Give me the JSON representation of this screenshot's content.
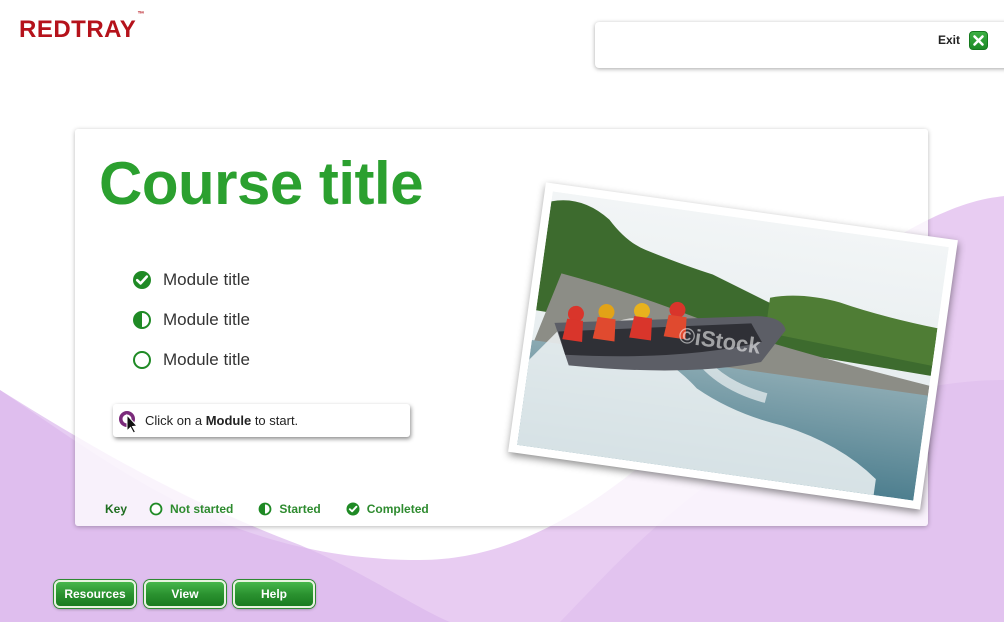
{
  "brand": {
    "name": "REDTRAY",
    "trademark": "™",
    "color": "#b5121b"
  },
  "header": {
    "exit_label": "Exit",
    "exit_icon": "close-icon"
  },
  "course": {
    "title": "Course title",
    "modules": [
      {
        "label": "Module title",
        "status": "completed"
      },
      {
        "label": "Module title",
        "status": "started"
      },
      {
        "label": "Module title",
        "status": "not-started"
      }
    ]
  },
  "tip": {
    "prefix": "Click on a ",
    "bold": "Module",
    "suffix": " to start.",
    "icon": "pointer-icon"
  },
  "key": {
    "label": "Key",
    "items": [
      {
        "label": "Not started",
        "status": "not-started"
      },
      {
        "label": "Started",
        "status": "started"
      },
      {
        "label": "Completed",
        "status": "completed"
      }
    ]
  },
  "photo": {
    "watermark": "©iStock"
  },
  "nav": {
    "resources": "Resources",
    "view": "View",
    "help": "Help"
  },
  "colors": {
    "accent": "#2ba02f",
    "lilac": "#e8ccf2",
    "tip_icon": "#7a2a7a"
  }
}
